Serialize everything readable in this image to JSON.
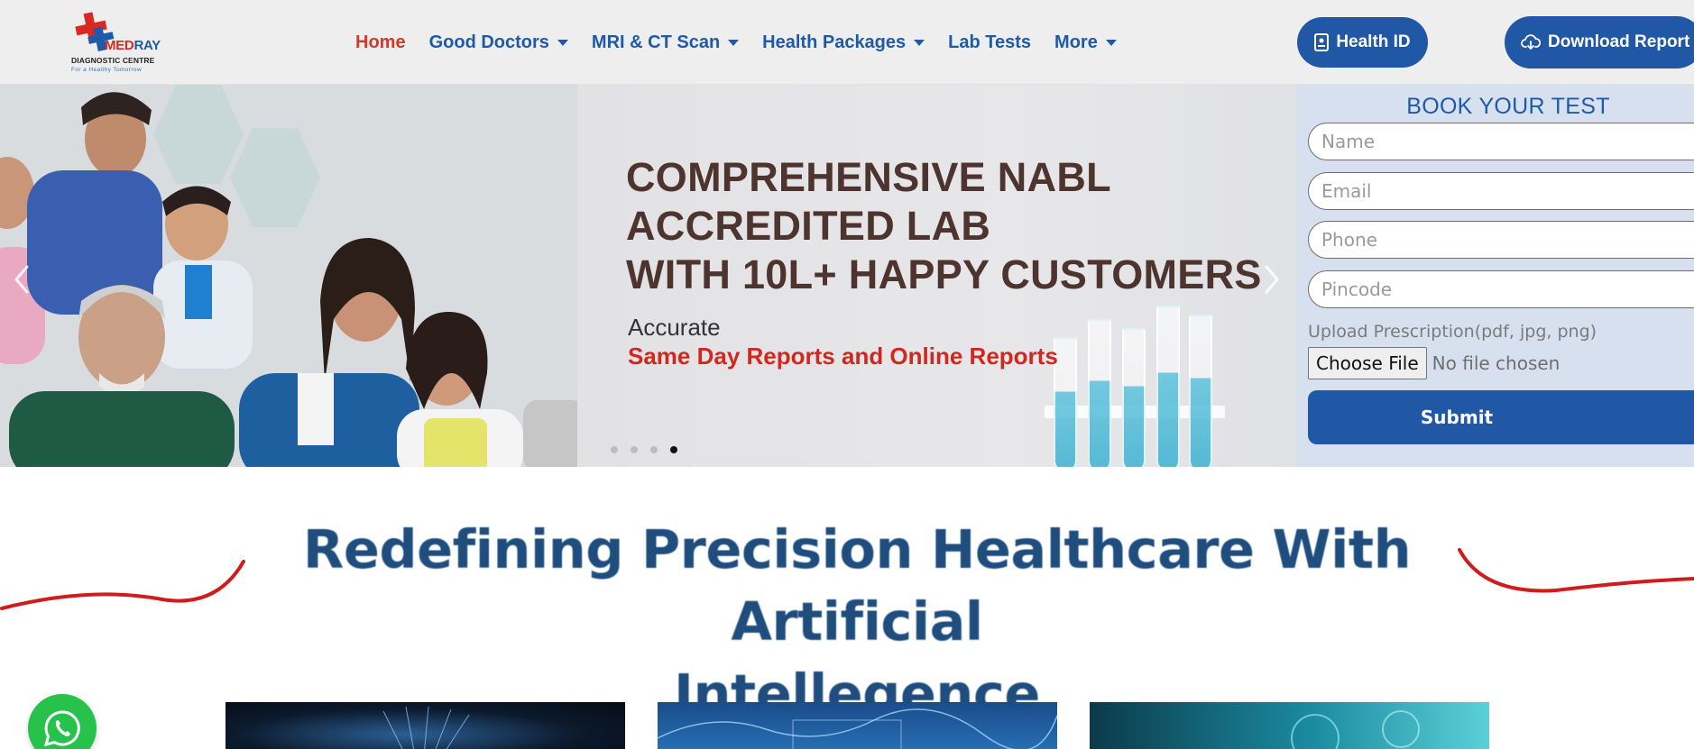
{
  "brand": {
    "name_part1": "MED",
    "name_part2": "RAY",
    "subtitle": "DIAGNOSTIC CENTRE",
    "tagline": "For a Healthy Tomorrow",
    "colors": {
      "blue": "#1e5aa8",
      "red": "#d9281f"
    }
  },
  "nav": {
    "items": [
      {
        "label": "Home",
        "active": true,
        "dropdown": false
      },
      {
        "label": "Good Doctors",
        "active": false,
        "dropdown": true
      },
      {
        "label": "MRI & CT Scan",
        "active": false,
        "dropdown": true
      },
      {
        "label": "Health Packages",
        "active": false,
        "dropdown": true
      },
      {
        "label": "Lab Tests",
        "active": false,
        "dropdown": false
      },
      {
        "label": "More",
        "active": false,
        "dropdown": true
      }
    ],
    "health_id_label": "Health ID",
    "health_id_icon": "id-card-icon",
    "download_label": "Download Report",
    "download_icon": "cloud-download-icon"
  },
  "hero": {
    "headline": [
      "COMPREHENSIVE NABL",
      "ACCREDITED LAB",
      "WITH 10L+ HAPPY CUSTOMERS"
    ],
    "sub1": "Accurate",
    "sub2": "Same Day Reports and Online Reports",
    "slide_count": 4,
    "active_slide": 4,
    "colors": {
      "headline": "#4e342e",
      "highlight": "#d0271f"
    }
  },
  "booking": {
    "title": "BOOK YOUR TEST",
    "fields": {
      "name_placeholder": "Name",
      "email_placeholder": "Email",
      "phone_placeholder": "Phone",
      "pincode_placeholder": "Pincode"
    },
    "upload_label": "Upload Prescription(pdf, jpg, png)",
    "file_button": "Choose File",
    "file_status": "No file chosen",
    "submit_label": "Submit"
  },
  "section": {
    "title_line1": "Redefining Precision Healthcare With Artificial",
    "title_line2": "Intellegence"
  },
  "whatsapp": {
    "icon": "whatsapp-icon",
    "color": "#27c24c"
  }
}
